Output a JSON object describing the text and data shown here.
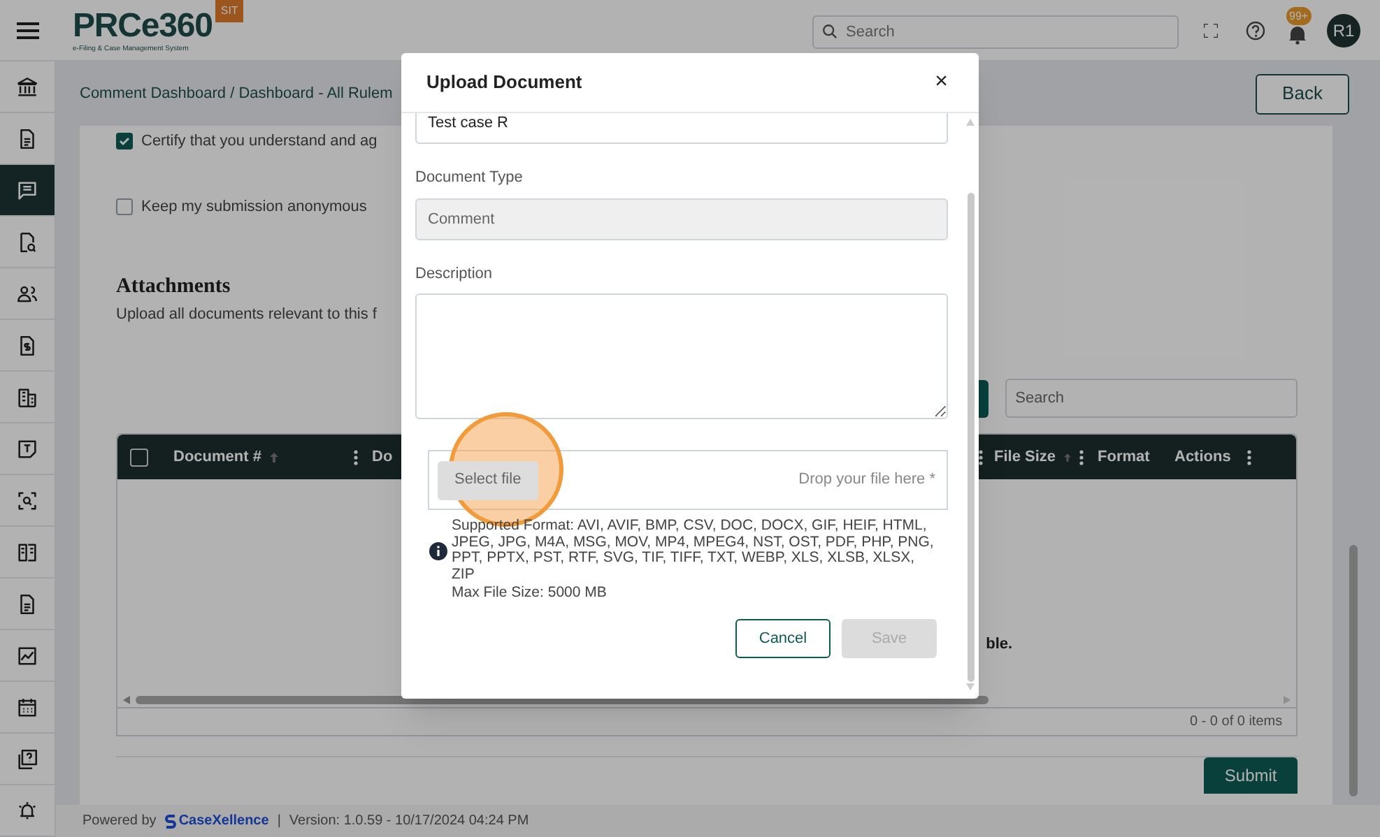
{
  "header": {
    "logo": "PRCe360",
    "logo_tagline": "e-Filing & Case Management System",
    "env_badge": "SIT",
    "search": {
      "placeholder": "Search"
    },
    "notification_count": "99+",
    "avatar": "R1"
  },
  "sidebar": {
    "items": [
      {
        "selected": false
      },
      {
        "selected": false
      },
      {
        "selected": true
      },
      {
        "selected": false
      },
      {
        "selected": false
      },
      {
        "selected": false
      },
      {
        "selected": false
      },
      {
        "selected": false
      },
      {
        "selected": false
      },
      {
        "selected": false
      },
      {
        "selected": false
      },
      {
        "selected": false
      },
      {
        "selected": false
      },
      {
        "selected": false
      },
      {
        "selected": false
      }
    ]
  },
  "breadcrumb": "Comment Dashboard / Dashboard - All Rulem",
  "back_button": "Back",
  "checkboxes": [
    {
      "label": "Certify that you understand and ag",
      "checked": true
    },
    {
      "label": "Keep my submission anonymous",
      "checked": false
    }
  ],
  "attachments": {
    "title": "Attachments",
    "subtitle": "Upload all documents relevant to this f",
    "search": {
      "placeholder": "Search"
    },
    "table": {
      "select_all": {
        "checked": false
      },
      "columns": [
        {
          "label": "Document #",
          "sortable": true
        },
        {
          "label": "Do"
        },
        {
          "label": "File Size",
          "sortable": true
        },
        {
          "label": "Format",
          "sortable": false
        },
        {
          "label": "Actions"
        }
      ],
      "empty_text": "ble.",
      "pager": "0 - 0 of 0 items"
    }
  },
  "submit_button": "Submit",
  "footer": {
    "powered_by": "Powered by",
    "brand": "CaseXellence",
    "separator": "|",
    "version": "Version: 1.0.59 - 10/17/2024 04:24 PM"
  },
  "modal": {
    "title": "Upload Document",
    "close": "×",
    "fields": [
      {
        "kind": "text",
        "value": "Test case R",
        "disabled": false
      },
      {
        "kind": "text",
        "label": "Document Type",
        "value": "Comment",
        "disabled": true
      },
      {
        "kind": "textarea",
        "label": "Description",
        "disabled": false
      }
    ],
    "upload": {
      "button": "Select file",
      "hint": "Drop your file here *",
      "formats": "Supported Format: AVI, AVIF, BMP, CSV, DOC, DOCX, GIF, HEIF, HTML, JPEG, JPG, M4A, MSG, MOV, MP4, MPEG4, NST, OST, PDF, PHP, PNG, PPT, PPTX, PST, RTF, SVG, TIF, TIFF, TXT, WEBP, XLS, XLSB, XLSX, ZIP",
      "max_size": "Max File Size: 5000 MB"
    },
    "buttons": [
      {
        "label": "Cancel",
        "disabled": false
      },
      {
        "label": "Save",
        "disabled": true
      }
    ]
  }
}
